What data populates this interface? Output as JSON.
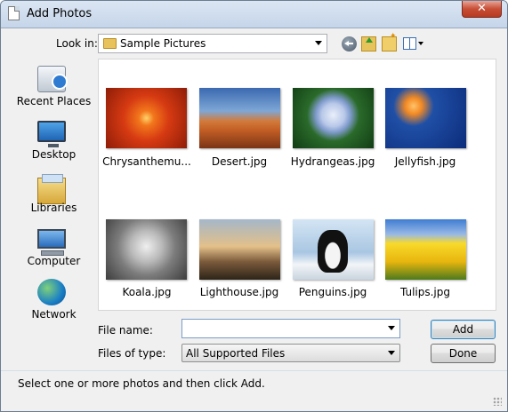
{
  "window": {
    "title": "Add Photos",
    "close_label": "✕"
  },
  "lookin": {
    "label": "Look in:",
    "value": "Sample Pictures"
  },
  "toolbar": {
    "icons": [
      "back-arrow-icon",
      "up-folder-icon",
      "new-folder-icon",
      "view-menu-icon"
    ]
  },
  "places": [
    {
      "label": "Recent Places",
      "icon": "recent-places-icon"
    },
    {
      "label": "Desktop",
      "icon": "desktop-icon"
    },
    {
      "label": "Libraries",
      "icon": "libraries-icon"
    },
    {
      "label": "Computer",
      "icon": "computer-icon"
    },
    {
      "label": "Network",
      "icon": "network-icon"
    }
  ],
  "files": [
    {
      "name": "Chrysanthemu..."
    },
    {
      "name": "Desert.jpg"
    },
    {
      "name": "Hydrangeas.jpg"
    },
    {
      "name": "Jellyfish.jpg"
    },
    {
      "name": "Koala.jpg"
    },
    {
      "name": "Lighthouse.jpg"
    },
    {
      "name": "Penguins.jpg"
    },
    {
      "name": "Tulips.jpg"
    }
  ],
  "filename": {
    "label": "File name:",
    "value": ""
  },
  "filetype": {
    "label": "Files of type:",
    "value": "All Supported Files"
  },
  "buttons": {
    "add": "Add",
    "done": "Done"
  },
  "status": "Select one or more photos and then click Add."
}
